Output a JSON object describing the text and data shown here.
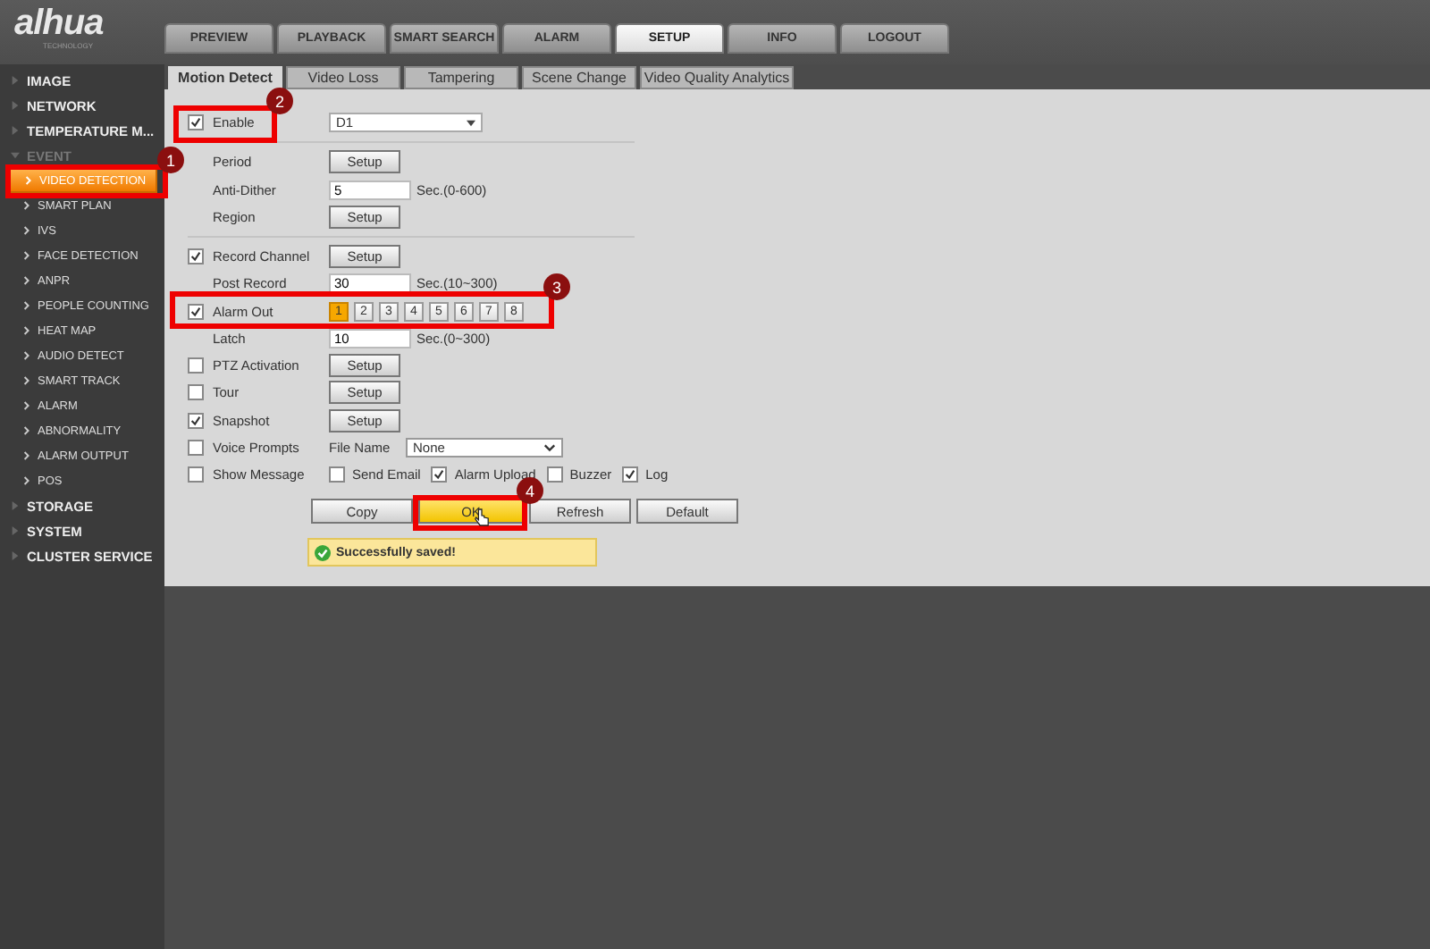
{
  "logo": {
    "name": "alhua",
    "tagline": "TECHNOLOGY"
  },
  "top_tabs": [
    {
      "label": "PREVIEW",
      "selected": false
    },
    {
      "label": "PLAYBACK",
      "selected": false
    },
    {
      "label": "SMART SEARCH",
      "selected": false
    },
    {
      "label": "ALARM",
      "selected": false
    },
    {
      "label": "SETUP",
      "selected": true
    },
    {
      "label": "INFO",
      "selected": false
    },
    {
      "label": "LOGOUT",
      "selected": false
    }
  ],
  "sidebar": {
    "items": [
      {
        "label": "IMAGE",
        "expanded": false
      },
      {
        "label": "NETWORK",
        "expanded": false
      },
      {
        "label": "TEMPERATURE M...",
        "expanded": false
      },
      {
        "label": "EVENT",
        "expanded": true,
        "children": [
          {
            "label": "VIDEO DETECTION",
            "selected": true
          },
          {
            "label": "SMART PLAN",
            "selected": false
          },
          {
            "label": "IVS",
            "selected": false
          },
          {
            "label": "FACE DETECTION",
            "selected": false
          },
          {
            "label": "ANPR",
            "selected": false
          },
          {
            "label": "PEOPLE COUNTING",
            "selected": false
          },
          {
            "label": "HEAT MAP",
            "selected": false
          },
          {
            "label": "AUDIO DETECT",
            "selected": false
          },
          {
            "label": "SMART TRACK",
            "selected": false
          },
          {
            "label": "ALARM",
            "selected": false
          },
          {
            "label": "ABNORMALITY",
            "selected": false
          },
          {
            "label": "ALARM OUTPUT",
            "selected": false
          },
          {
            "label": "POS",
            "selected": false
          }
        ]
      },
      {
        "label": "STORAGE",
        "expanded": false
      },
      {
        "label": "SYSTEM",
        "expanded": false
      },
      {
        "label": "CLUSTER SERVICE",
        "expanded": false
      }
    ]
  },
  "sub_tabs": [
    {
      "label": "Motion Detect",
      "selected": true
    },
    {
      "label": "Video Loss",
      "selected": false
    },
    {
      "label": "Tampering",
      "selected": false
    },
    {
      "label": "Scene Change",
      "selected": false
    },
    {
      "label": "Video Quality Analytics",
      "selected": false
    }
  ],
  "sections": [
    [
      {
        "kind": "select",
        "label": "Enable",
        "checked": true,
        "value": "D1"
      }
    ],
    [
      {
        "kind": "setup",
        "label": "Period",
        "button": "Setup"
      },
      {
        "kind": "input",
        "label": "Anti-Dither",
        "value": "5",
        "hint": "Sec.(0-600)"
      },
      {
        "kind": "setup",
        "label": "Region",
        "button": "Setup"
      }
    ],
    [
      {
        "kind": "setup",
        "label": "Record Channel",
        "checked": true,
        "button": "Setup"
      },
      {
        "kind": "input",
        "label": "Post Record",
        "value": "30",
        "hint": "Sec.(10~300)"
      },
      {
        "kind": "channels",
        "label": "Alarm Out",
        "checked": true,
        "channels": [
          {
            "label": "1",
            "selected": true
          },
          {
            "label": "2",
            "selected": false
          },
          {
            "label": "3",
            "selected": false
          },
          {
            "label": "4",
            "selected": false
          },
          {
            "label": "5",
            "selected": false
          },
          {
            "label": "6",
            "selected": false
          },
          {
            "label": "7",
            "selected": false
          },
          {
            "label": "8",
            "selected": false
          }
        ]
      },
      {
        "kind": "input",
        "label": "Latch",
        "value": "10",
        "hint": "Sec.(0~300)"
      },
      {
        "kind": "setup",
        "label": "PTZ Activation",
        "checked": false,
        "button": "Setup"
      },
      {
        "kind": "setup",
        "label": "Tour",
        "checked": false,
        "button": "Setup"
      },
      {
        "kind": "setup",
        "label": "Snapshot",
        "checked": true,
        "button": "Setup"
      },
      {
        "kind": "file",
        "label": "Voice Prompts",
        "checked": false,
        "field_label": "File Name",
        "value": "None"
      },
      {
        "kind": "options",
        "label": "Show Message",
        "checked": false,
        "options": [
          {
            "label": "Send Email",
            "checked": false
          },
          {
            "label": "Alarm Upload",
            "checked": true
          },
          {
            "label": "Buzzer",
            "checked": false
          },
          {
            "label": "Log",
            "checked": true
          }
        ]
      }
    ]
  ],
  "buttons": [
    {
      "label": "Copy",
      "selected": false
    },
    {
      "label": "OK",
      "selected": true
    },
    {
      "label": "Refresh",
      "selected": false
    },
    {
      "label": "Default",
      "selected": false
    }
  ],
  "status_message": "Successfully saved!",
  "annotations": [
    {
      "label": "1"
    },
    {
      "label": "2"
    },
    {
      "label": "3"
    },
    {
      "label": "4"
    }
  ]
}
